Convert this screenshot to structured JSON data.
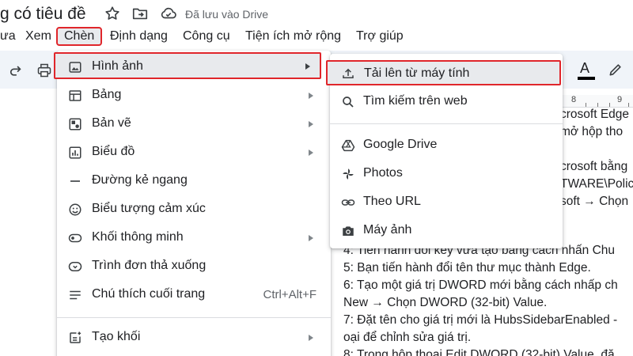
{
  "title_bar": {
    "doc_title": "g có tiêu đề",
    "save_status": "Đã lưu vào Drive",
    "icons": [
      "star-icon",
      "move-to-folder-icon",
      "cloud-saved-icon"
    ]
  },
  "menubar": {
    "items": [
      "ưa",
      "Xem",
      "Chèn",
      "Định dạng",
      "Công cụ",
      "Tiện ích mở rộng",
      "Trợ giúp"
    ],
    "active": "Chèn"
  },
  "toolbar": {
    "icons": [
      "redo-icon",
      "print-icon",
      "text-color-icon",
      "highlight-pen-icon"
    ],
    "text_color_glyph": "A"
  },
  "ruler": {
    "labels": [
      "8",
      "9"
    ]
  },
  "insert_menu": {
    "items": [
      {
        "label": "Hình ảnh",
        "icon": "image-icon",
        "has_submenu": true,
        "highlighted": true
      },
      {
        "label": "Bảng",
        "icon": "table-icon",
        "has_submenu": true
      },
      {
        "label": "Bản vẽ",
        "icon": "drawing-icon",
        "has_submenu": true
      },
      {
        "label": "Biểu đồ",
        "icon": "chart-icon",
        "has_submenu": true
      },
      {
        "label": "Đường kẻ ngang",
        "icon": "horizontal-line-icon",
        "has_submenu": false
      },
      {
        "label": "Biểu tượng cảm xúc",
        "icon": "emoji-icon",
        "has_submenu": false
      },
      {
        "label": "Khối thông minh",
        "icon": "smart-chips-icon",
        "has_submenu": true
      },
      {
        "label": "Trình đơn thả xuống",
        "icon": "dropdown-icon",
        "has_submenu": false
      },
      {
        "label": "Chú thích cuối trang",
        "icon": "footnote-icon",
        "shortcut": "Ctrl+Alt+F",
        "has_submenu": false
      },
      {
        "label": "Tạo khối",
        "icon": "building-blocks-icon",
        "has_submenu": true
      }
    ]
  },
  "image_submenu": {
    "items": [
      {
        "label": "Tải lên từ máy tính",
        "icon": "upload-icon",
        "highlighted": true
      },
      {
        "label": "Tìm kiếm trên web",
        "icon": "search-icon"
      },
      {
        "label": "Google Drive",
        "icon": "google-drive-icon"
      },
      {
        "label": "Photos",
        "icon": "photos-pinwheel-icon"
      },
      {
        "label": "Theo URL",
        "icon": "link-icon"
      },
      {
        "label": "Máy ảnh",
        "icon": "camera-icon"
      }
    ]
  },
  "document_lines": [
    "crosoft Edge",
    "mở hộp tho",
    "",
    "crosoft bằng",
    "TWARE\\Polic",
    "soft → Chọn",
    "",
    "",
    "4: Tiến hành đổi key vừa tạo bằng cách nhấn Chu",
    "5: Bạn tiến hành đổi tên thư mục thành Edge.",
    "6: Tạo một giá trị DWORD mới bằng cách nhấp ch",
    "New → Chọn DWORD (32-bit) Value.",
    "7: Đặt tên cho giá trị mới là HubsSidebarEnabled -",
    "oại để chỉnh sửa giá trị.",
    "8: Trong hộp thoại Edit DWORD (32-bit) Value, đặ"
  ]
}
